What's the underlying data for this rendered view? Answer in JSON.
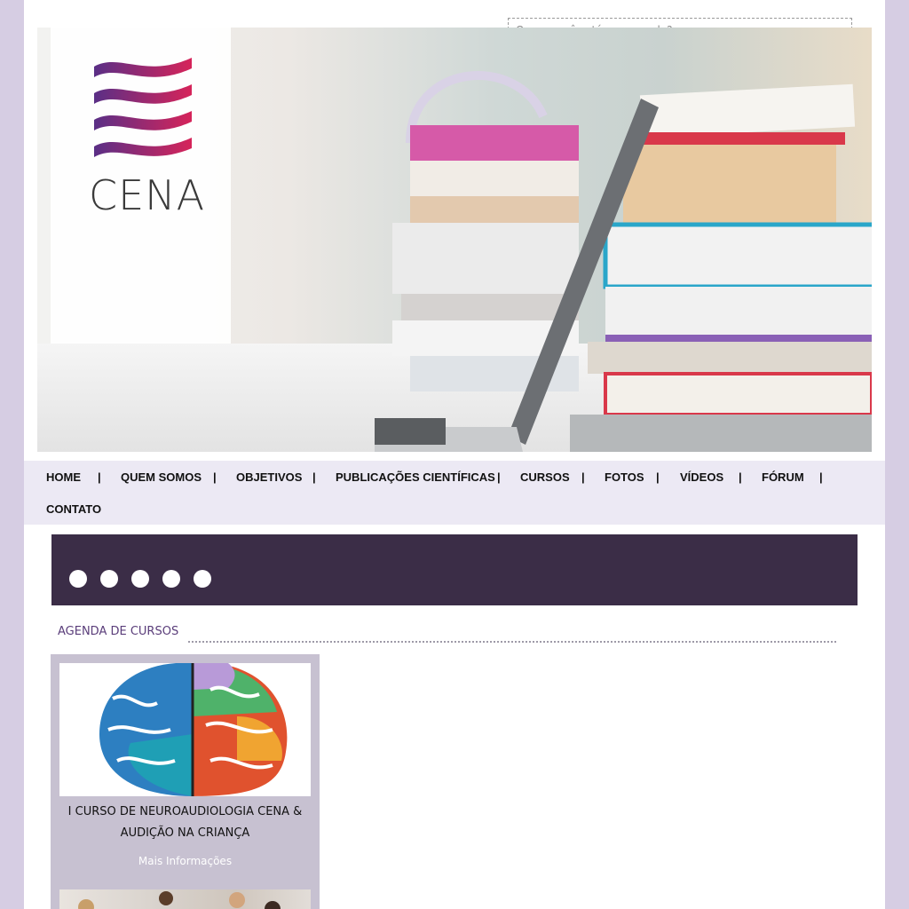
{
  "search": {
    "placeholder": "O que você está procurando?"
  },
  "banner": {
    "brand": "CENA"
  },
  "nav": {
    "items": [
      "HOME",
      "QUEM SOMOS",
      "OBJETIVOS",
      "PUBLICAÇÕES CIENTÍFICAS",
      "CURSOS",
      "FOTOS",
      "VÍDEOS",
      "FÓRUM",
      "CONTATO"
    ],
    "separator": "|"
  },
  "slider": {
    "dot_count": 5
  },
  "agenda": {
    "title": "AGENDA DE CURSOS",
    "courses": [
      {
        "title_line1": "I CURSO DE NEUROAUDIOLOGIA CENA &",
        "title_line2": "AUDIÇÃO NA CRIANÇA",
        "more": "Mais Informações"
      }
    ]
  },
  "colors": {
    "background": "#d6cde3",
    "nav_bg": "#ece9f4",
    "slider_bg": "#3b2d47",
    "card_bg": "#c7c1d1",
    "accent": "#5a3d7a"
  }
}
